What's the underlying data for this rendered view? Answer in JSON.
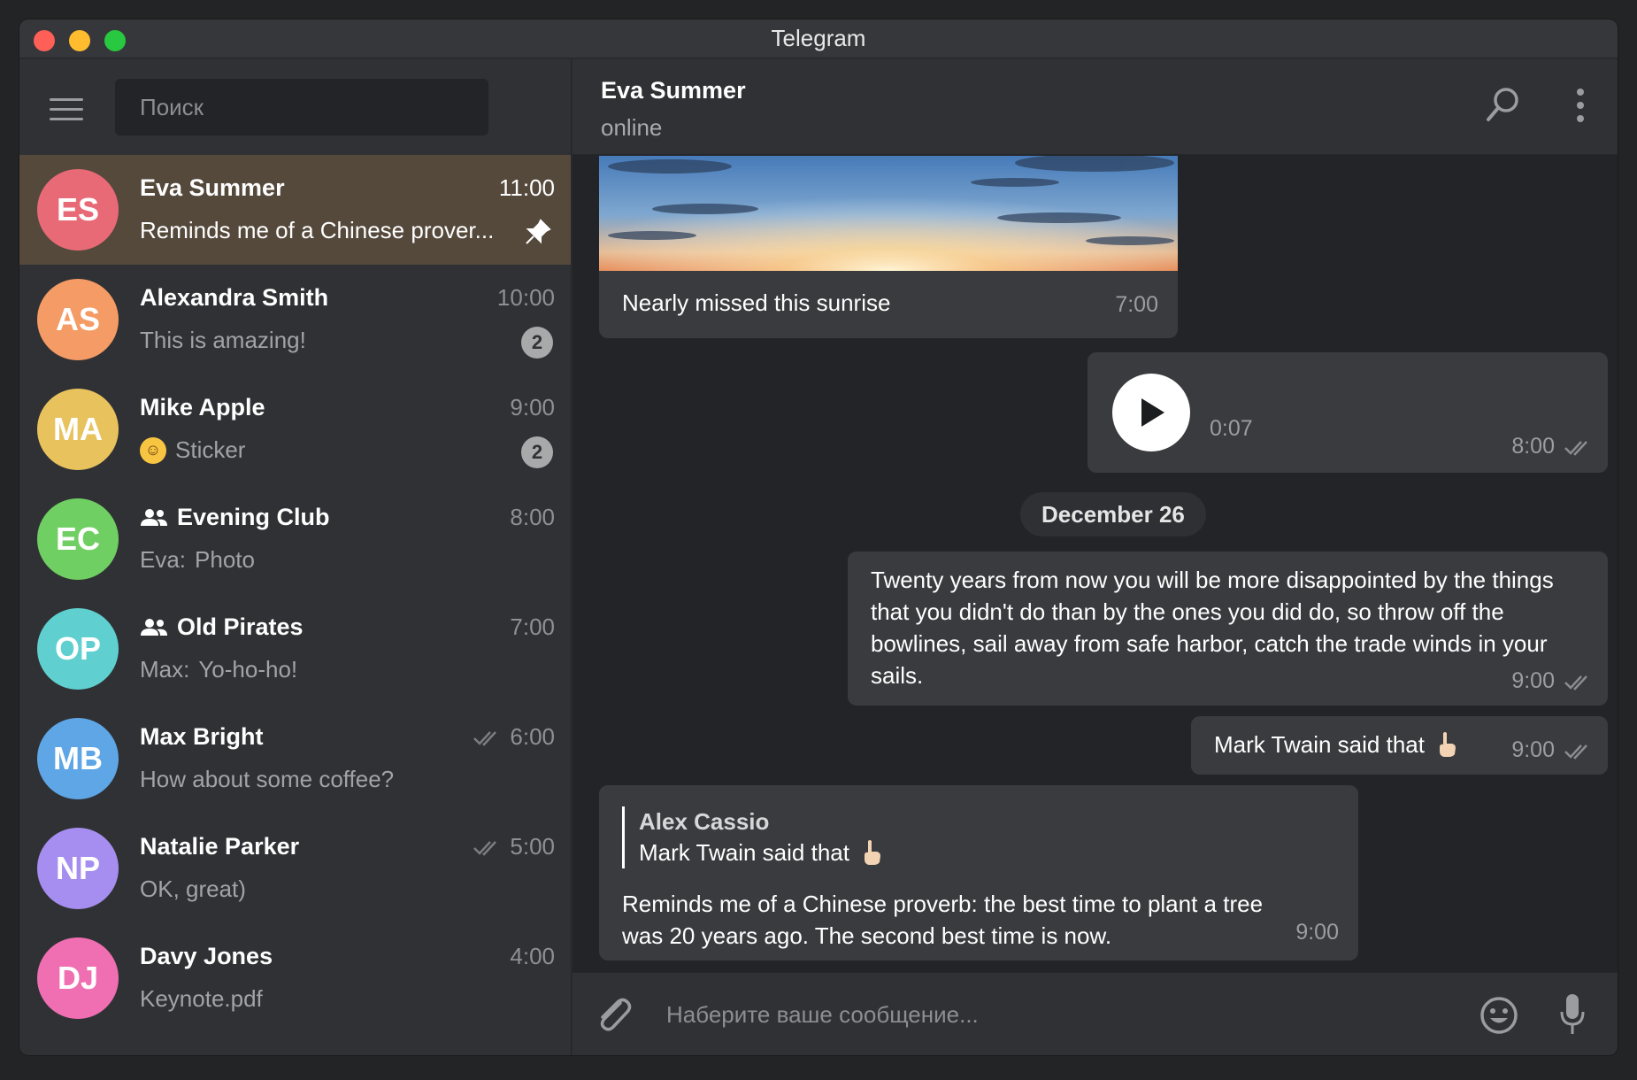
{
  "window": {
    "title": "Telegram"
  },
  "search": {
    "placeholder": "Поиск"
  },
  "chats": [
    {
      "initials": "ES",
      "name": "Eva Summer",
      "time": "11:00",
      "preview": "Reminds me of a Chinese prover...",
      "color": "#e86a76",
      "active": true,
      "pinned": true
    },
    {
      "initials": "AS",
      "name": "Alexandra Smith",
      "time": "10:00",
      "preview": "This is amazing!",
      "color": "#f59b66",
      "badge": "2"
    },
    {
      "initials": "MA",
      "name": "Mike Apple",
      "time": "9:00",
      "preview": "Sticker",
      "color": "#e8c25d",
      "badge": "2",
      "emoji": "😄"
    },
    {
      "initials": "EC",
      "name": "Evening Club",
      "time": "8:00",
      "preview_sender": "Eva:",
      "preview": "Photo",
      "color": "#6fcf62",
      "group": true
    },
    {
      "initials": "OP",
      "name": "Old Pirates",
      "time": "7:00",
      "preview_sender": "Max:",
      "preview": "Yo-ho-ho!",
      "color": "#5fcfcf",
      "group": true
    },
    {
      "initials": "MB",
      "name": "Max Bright",
      "time": "6:00",
      "preview": "How about some coffee?",
      "color": "#5ea6e6",
      "read": true
    },
    {
      "initials": "NP",
      "name": "Natalie Parker",
      "time": "5:00",
      "preview": "OK, great)",
      "color": "#a68ef0",
      "read": true
    },
    {
      "initials": "DJ",
      "name": "Davy Jones",
      "time": "4:00",
      "preview": "Keynote.pdf",
      "color": "#ef6fb2"
    }
  ],
  "header": {
    "name": "Eva Summer",
    "status": "online"
  },
  "messages": {
    "photo": {
      "caption": "Nearly missed this sunrise",
      "time": "7:00"
    },
    "voice": {
      "duration": "0:07",
      "time": "8:00"
    },
    "date_divider": "December 26",
    "quote": {
      "text": "Twenty years from now you will be more disappointed by the things that you didn't do than by the ones you did do, so throw off the bowlines, sail away from safe harbor, catch the trade winds in your sails.",
      "time": "9:00"
    },
    "twain": {
      "text": "Mark Twain said that",
      "time": "9:00"
    },
    "reply": {
      "author": "Alex Cassio",
      "snippet": "Mark Twain said that",
      "text": "Reminds me of a Chinese proverb: the best time to plant a tree was 20 years ago. The second best time is now.",
      "time": "9:00"
    }
  },
  "composer": {
    "placeholder": "Наберите ваше сообщение..."
  }
}
